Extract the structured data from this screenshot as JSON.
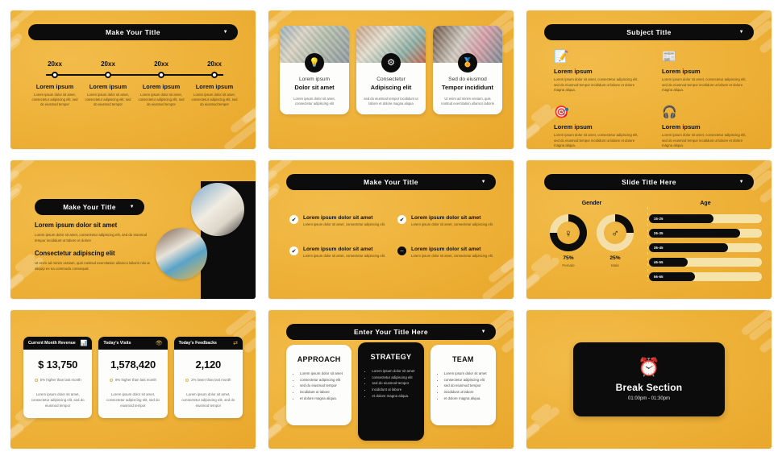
{
  "colors": {
    "background": "#eeb138",
    "accent": "#f2bc4a",
    "dark": "#0c0c0c",
    "card": "#fdfdfb",
    "bar_track": "#f6e3a9"
  },
  "slides": [
    {
      "id": "timeline",
      "title": "Make Your Title",
      "caret": "▼",
      "years": [
        "20xx",
        "20xx",
        "20xx",
        "20xx"
      ],
      "items": [
        {
          "heading": "Lorem ipsum",
          "body": "Lorem ipsum dolor sit amet, consectetur adipiscing elit, sed do eiusmod tempor"
        },
        {
          "heading": "Lorem ipsum",
          "body": "Lorem ipsum dolor sit amet, consectetur adipiscing elit, sed do eiusmod tempor"
        },
        {
          "heading": "Lorem ipsum",
          "body": "Lorem ipsum dolor sit amet, consectetur adipiscing elit, sed do eiusmod tempor"
        },
        {
          "heading": "Lorem ipsum",
          "body": "Lorem ipsum dolor sit amet, consectetur adipiscing elit, sed do eiusmod tempor"
        }
      ]
    },
    {
      "id": "photo-cards",
      "cards": [
        {
          "icon": "💡",
          "icon_name": "lightbulb-icon",
          "subtitle": "Lorem ipsum",
          "title": "Dolor sit amet",
          "body": "Lorem ipsum dolor sit amet, consectetur adipiscing elit"
        },
        {
          "icon": "⚙",
          "icon_name": "gear-icon",
          "subtitle": "Consectetur",
          "title": "Adipiscing elit",
          "body": "sed do eiusmod tempor incididunt ut labore et dolore magna aliqua"
        },
        {
          "icon": "🏅",
          "icon_name": "medal-icon",
          "subtitle": "Sed do eiusmod",
          "title": "Tempor incididunt",
          "body": "Ut enim ad minim veniam, quis nostrud exercitation ullamco laboris"
        }
      ]
    },
    {
      "id": "subject-icons",
      "title": "Subject Title",
      "caret": "▼",
      "items": [
        {
          "icon": "📝",
          "icon_name": "document-edit-icon",
          "heading": "Lorem ipsum",
          "body": "Lorem ipsum dolor sit amet, consectetur adipiscing elit, sed do eiusmod tempor incididunt ut labore et dolore magna aliqua."
        },
        {
          "icon": "📰",
          "icon_name": "news-document-icon",
          "heading": "Lorem ipsum",
          "body": "Lorem ipsum dolor sit amet, consectetur adipiscing elit, sed do eiusmod tempor incididunt ut labore et dolore magna aliqua."
        },
        {
          "icon": "🎯",
          "icon_name": "target-icon",
          "heading": "Lorem ipsum",
          "body": "Lorem ipsum dolor sit amet, consectetur adipiscing elit, sed do eiusmod tempor incididunt ut labore et dolore magna aliqua."
        },
        {
          "icon": "🎧",
          "icon_name": "headset-support-icon",
          "heading": "Lorem ipsum",
          "body": "Lorem ipsum dolor sit amet, consectetur adipiscing elit, sed do eiusmod tempor incididunt ut labore et dolore magna aliqua."
        }
      ]
    },
    {
      "id": "text-photos",
      "title": "Make Your Title",
      "caret": "▼",
      "heading1": "Lorem ipsum dolor sit amet",
      "body1": "Lorem ipsum dolor sit amet, consectetur adipiscing elit, sed do eiusmod tempor incididunt ut labore et dolore",
      "heading2": "Consectetur adipiscing elit",
      "body2": "Ut enim ad minim veniam, quis nostrud exercitation ullamco laboris nisi ut aliquip ex ea commodo consequat"
    },
    {
      "id": "checklist",
      "title": "Make Your Title",
      "caret": "▼",
      "items": [
        {
          "mark": "check",
          "glyph": "✔",
          "heading": "Lorem ipsum dolor sit amet",
          "body": "Lorem ipsum dolor sit amet, consectetur adipiscing elit."
        },
        {
          "mark": "check",
          "glyph": "✔",
          "heading": "Lorem ipsum dolor sit amet",
          "body": "Lorem ipsum dolor sit amet, consectetur adipiscing elit."
        },
        {
          "mark": "check",
          "glyph": "✔",
          "heading": "Lorem ipsum dolor sit amet",
          "body": "Lorem ipsum dolor sit amet, consectetur adipiscing elit."
        },
        {
          "mark": "minus",
          "glyph": "➖",
          "heading": "Lorem ipsum dolor sit amet",
          "body": "Lorem ipsum dolor sit amet, consectetur adipiscing elit."
        }
      ]
    },
    {
      "id": "demographics",
      "title": "Slide Title Here",
      "caret": "▼",
      "gender_label": "Gender",
      "age_label": "Age",
      "gender": [
        {
          "percent": "75%",
          "label": "Female",
          "value": 75,
          "icon": "👩",
          "icon_name": "female-figure-icon"
        },
        {
          "percent": "25%",
          "label": "Male",
          "value": 25,
          "icon": "🚹",
          "icon_name": "male-figure-icon"
        }
      ],
      "age_bars": [
        {
          "label": "15-25",
          "value": 57
        },
        {
          "label": "26-35",
          "value": 81
        },
        {
          "label": "36-45",
          "value": 70
        },
        {
          "label": "46-55",
          "value": 34
        },
        {
          "label": "56-65",
          "value": 41
        }
      ]
    },
    {
      "id": "kpi",
      "cards": [
        {
          "header": "Current Month Revenue",
          "icon": "📊",
          "icon_name": "bar-chart-icon",
          "value": "$ 13,750",
          "delta": "5% higher than last month",
          "body": "Lorem ipsum dolor sit amet, consectetur adipiscing elit, sed do eiusmod tempor"
        },
        {
          "header": "Today's Visits",
          "icon": "👁",
          "icon_name": "eye-icon",
          "value": "1,578,420",
          "delta": "9% higher than last month",
          "body": "Lorem ipsum dolor sit amet, consectetur adipiscing elit, sed do eiusmod tempor"
        },
        {
          "header": "Today's Feedbacks",
          "icon": "⇄",
          "icon_name": "exchange-arrows-icon",
          "value": "2,120",
          "delta": "2% lower than last month",
          "body": "Lorem ipsum dolor sit amet, consectetur adipiscing elit, sed do eiusmod tempor"
        }
      ]
    },
    {
      "id": "three-columns",
      "title": "Enter Your Title Here",
      "caret": "▼",
      "columns": [
        {
          "heading": "APPROACH",
          "dark": false,
          "bullets": [
            "Lorem ipsum dolor sit amet",
            "consectetur adipiscing elit",
            "sed do eiusmod tempor",
            "incididunt ut labore",
            "et dolore magna aliqua."
          ]
        },
        {
          "heading": "STRATEGY",
          "dark": true,
          "bullets": [
            "Lorem ipsum dolor sit amet",
            "consectetur adipiscing elit",
            "sed do eiusmod tempor",
            "incididunt ut labore",
            "et dolore magna aliqua."
          ]
        },
        {
          "heading": "TEAM",
          "dark": false,
          "bullets": [
            "Lorem ipsum dolor sit amet",
            "consectetur adipiscing elit",
            "sed do eiusmod tempor",
            "incididunt ut labore",
            "et dolore magna aliqua."
          ]
        }
      ]
    },
    {
      "id": "break",
      "icon": "⏰",
      "icon_name": "alarm-clock-icon",
      "title": "Break Section",
      "time": "01:00pm - 01:30pm"
    }
  ]
}
